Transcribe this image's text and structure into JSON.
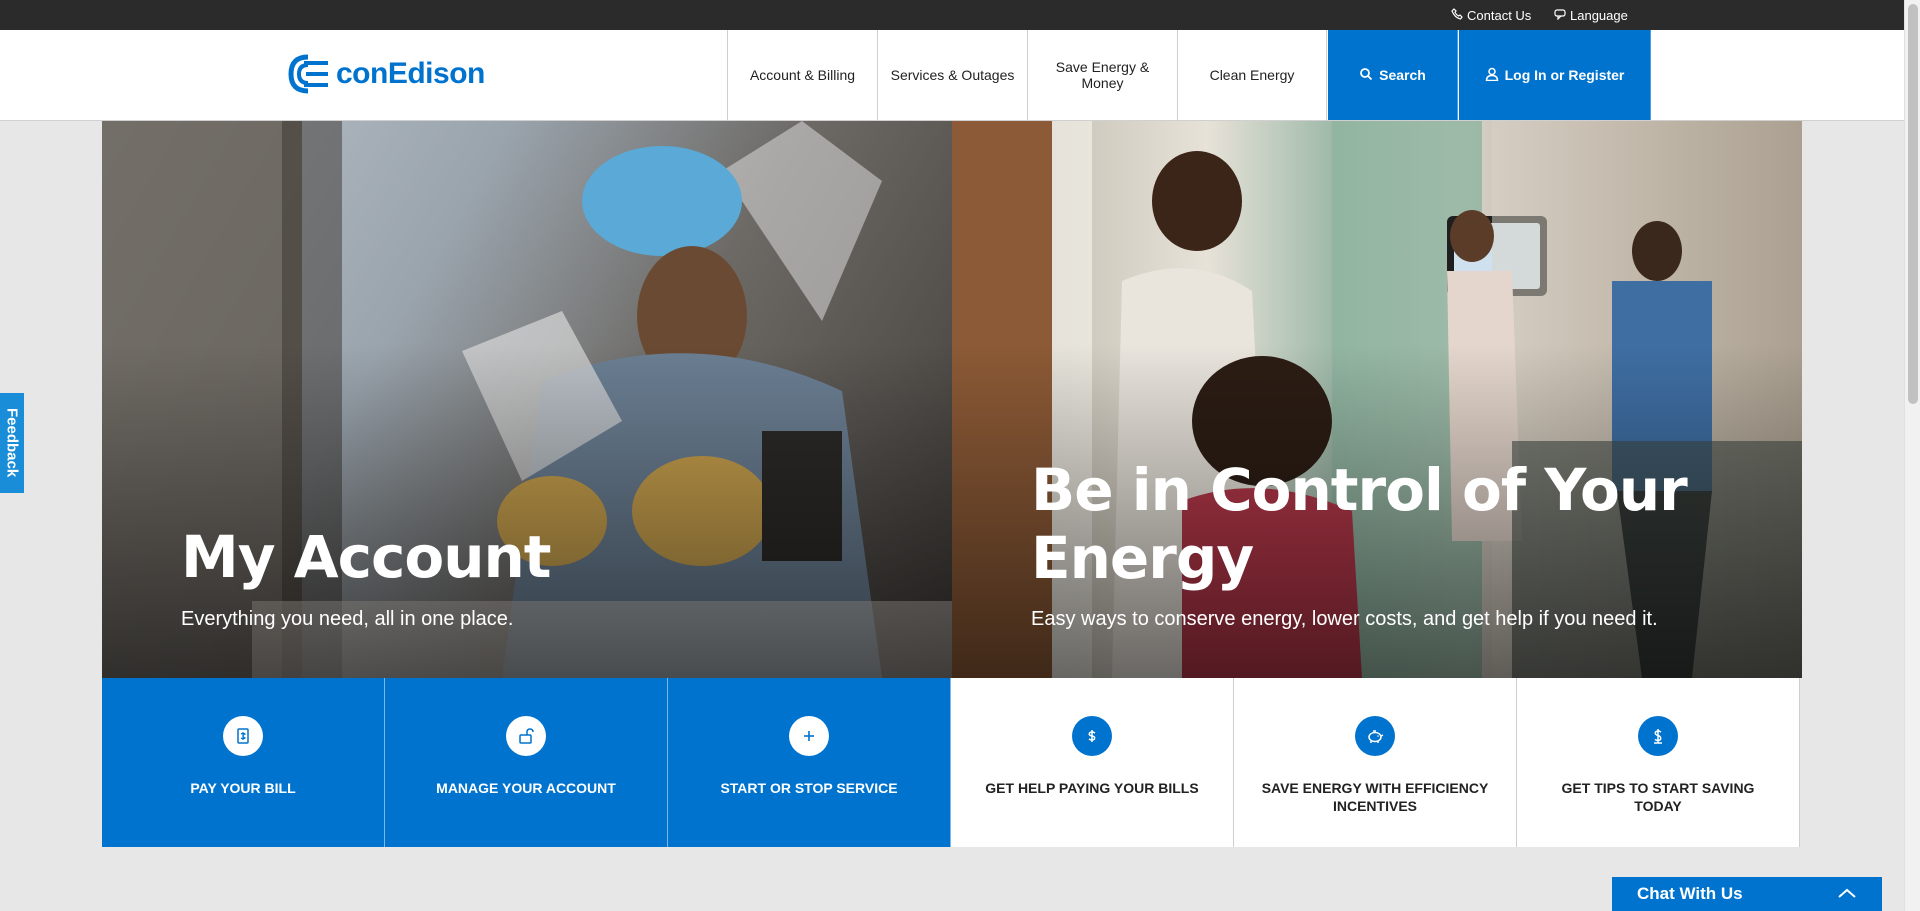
{
  "utility": {
    "contact": {
      "label": "Contact Us",
      "icon": "phone-icon"
    },
    "language": {
      "label": "Language",
      "icon": "speech-bubble-icon"
    }
  },
  "header": {
    "logo_text": "conEdison",
    "brand_color": "#0073cf",
    "nav": [
      {
        "label": "Account & Billing"
      },
      {
        "label": "Services & Outages"
      },
      {
        "label": "Save Energy & Money"
      },
      {
        "label": "Clean Energy"
      }
    ],
    "search_label": "Search",
    "login_label": "Log In or Register"
  },
  "feedback_label": "Feedback",
  "hero": {
    "left": {
      "title": "My Account",
      "subtitle": "Everything you need, all in one place."
    },
    "right": {
      "title": "Be in Control of Your Energy",
      "subtitle": "Easy ways to conserve energy, lower costs, and get help if you need it."
    }
  },
  "tiles": [
    {
      "label": "PAY YOUR BILL",
      "icon": "bill-icon",
      "style": "blue"
    },
    {
      "label": "MANAGE YOUR ACCOUNT",
      "icon": "unlock-icon",
      "style": "blue"
    },
    {
      "label": "START OR STOP SERVICE",
      "icon": "plus-icon",
      "style": "blue"
    },
    {
      "label": "GET HELP PAYING YOUR BILLS",
      "icon": "dollar-icon",
      "style": "white"
    },
    {
      "label": "SAVE ENERGY WITH EFFICIENCY INCENTIVES",
      "icon": "piggy-bank-icon",
      "style": "white"
    },
    {
      "label": "GET TIPS TO START SAVING TODAY",
      "icon": "dollar-coin-icon",
      "style": "white"
    }
  ],
  "chat": {
    "label": "Chat With Us"
  }
}
